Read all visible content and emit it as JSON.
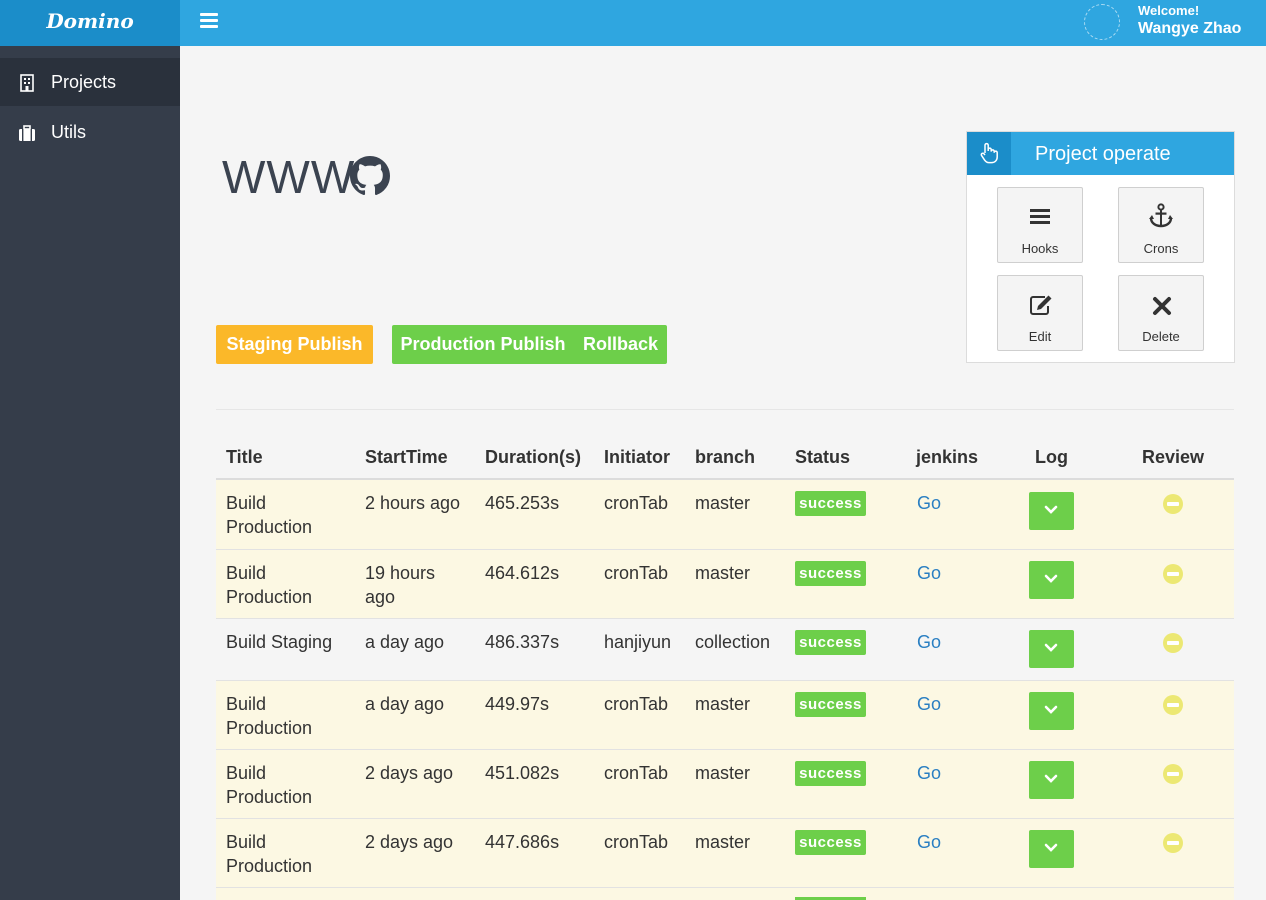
{
  "app": {
    "brand": "Domino"
  },
  "header": {
    "welcome": "Welcome!",
    "username": "Wangye Zhao"
  },
  "sidebar": {
    "items": [
      {
        "label": "Projects",
        "icon": "building-icon",
        "active": true
      },
      {
        "label": "Utils",
        "icon": "briefcase-icon",
        "active": false
      }
    ]
  },
  "project": {
    "title": "WWW",
    "icon": "github-icon"
  },
  "actions": {
    "staging_publish": "Staging Publish",
    "production_publish": "Production Publish",
    "rollback": "Rollback"
  },
  "operate": {
    "title": "Project operate",
    "buttons": [
      {
        "label": "Hooks",
        "icon": "list-icon"
      },
      {
        "label": "Crons",
        "icon": "anchor-icon"
      },
      {
        "label": "Edit",
        "icon": "edit-icon"
      },
      {
        "label": "Delete",
        "icon": "times-icon"
      }
    ]
  },
  "table": {
    "columns": [
      "Title",
      "StartTime",
      "Duration(s)",
      "Initiator",
      "branch",
      "Status",
      "jenkins",
      "Log",
      "Review"
    ],
    "rows": [
      {
        "title": [
          "Build",
          "Production"
        ],
        "start": [
          "2 hours ago"
        ],
        "duration": "465.253s",
        "initiator": "cronTab",
        "branch": "master",
        "status": "success",
        "jenkins": "Go"
      },
      {
        "title": [
          "Build",
          "Production"
        ],
        "start": [
          "19 hours",
          "ago"
        ],
        "duration": "464.612s",
        "initiator": "cronTab",
        "branch": "master",
        "status": "success",
        "jenkins": "Go"
      },
      {
        "title": [
          "Build Staging"
        ],
        "start": [
          "a day ago"
        ],
        "duration": "486.337s",
        "initiator": "hanjiyun",
        "branch": "collection",
        "status": "success",
        "jenkins": "Go"
      },
      {
        "title": [
          "Build",
          "Production"
        ],
        "start": [
          "a day ago"
        ],
        "duration": "449.97s",
        "initiator": "cronTab",
        "branch": "master",
        "status": "success",
        "jenkins": "Go"
      },
      {
        "title": [
          "Build",
          "Production"
        ],
        "start": [
          "2 days ago"
        ],
        "duration": "451.082s",
        "initiator": "cronTab",
        "branch": "master",
        "status": "success",
        "jenkins": "Go"
      },
      {
        "title": [
          "Build",
          "Production"
        ],
        "start": [
          "2 days ago"
        ],
        "duration": "447.686s",
        "initiator": "cronTab",
        "branch": "master",
        "status": "success",
        "jenkins": "Go"
      },
      {
        "title": [
          ""
        ],
        "start": [
          ""
        ],
        "duration": "",
        "initiator": "",
        "branch": "",
        "status": "",
        "jenkins": ""
      }
    ]
  },
  "colors": {
    "topbar": "#2fa6e0",
    "brand_bg": "#1b8dc9",
    "sidebar": "#353d4a",
    "staging": "#fbb829",
    "success": "#6dcf4a",
    "link": "#2a7fc2",
    "row_highlight": "#fcf8e3",
    "review": "#ece873"
  }
}
